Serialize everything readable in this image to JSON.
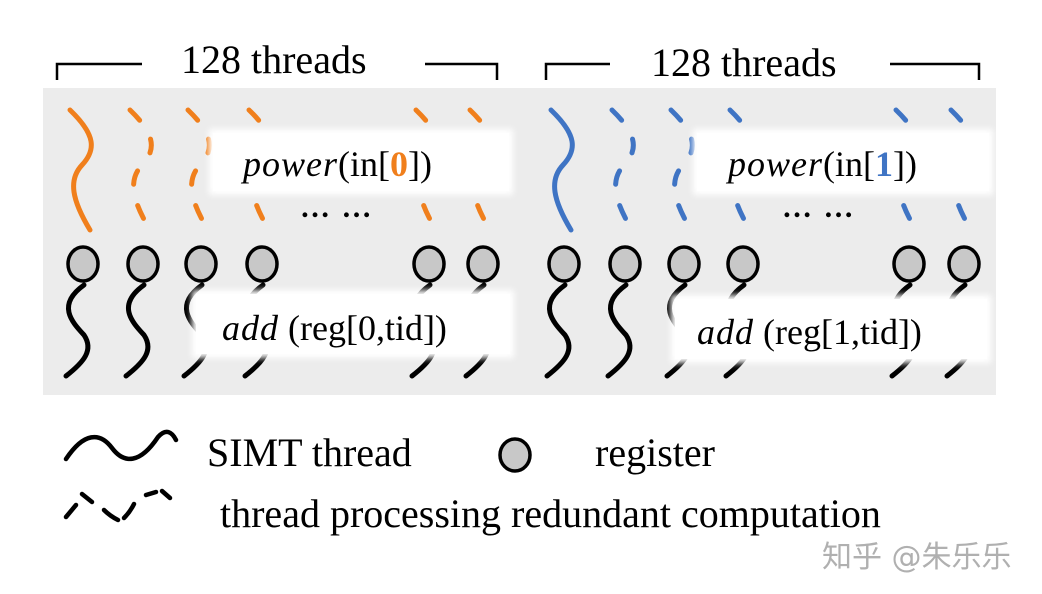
{
  "groups": [
    {
      "title": "128 threads",
      "color": "#f07f1c",
      "op_label": {
        "function": "power",
        "prefix": "(in[",
        "index": "0",
        "suffix": "])"
      },
      "add_label": {
        "function": "add",
        "args": "(reg[0,tid])"
      },
      "ellipsis": "… …"
    },
    {
      "title": "128 threads",
      "color": "#3f74c4",
      "op_label": {
        "function": "power",
        "prefix": "(in[",
        "index": "1",
        "suffix": "])"
      },
      "add_label": {
        "function": "add",
        "args": "(reg[1,tid])"
      },
      "ellipsis": "… …"
    }
  ],
  "legend": {
    "simt_thread": "SIMT thread",
    "register": "register",
    "redundant_thread": "thread processing redundant computation"
  },
  "colors": {
    "panel_background": "#ececec",
    "register_fill": "#c8c8c8",
    "thread_black": "#000000"
  },
  "watermark": "知乎 @朱乐乐"
}
